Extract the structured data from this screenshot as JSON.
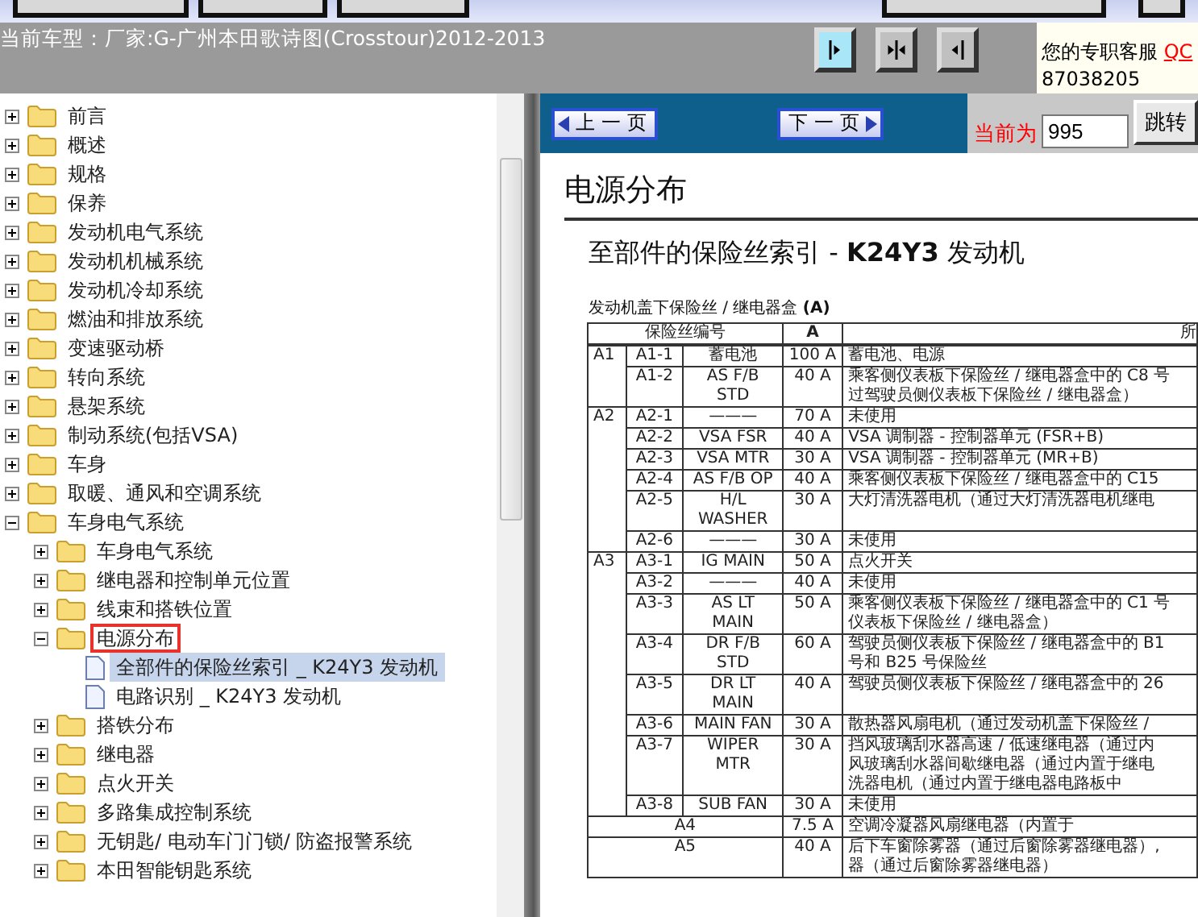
{
  "header": {
    "model_text": "当前车型：厂家:G-广州本田歌诗图(Crosstour)2012-2013",
    "view_buttons": [
      {
        "kind": "right"
      },
      {
        "kind": "both"
      },
      {
        "kind": "left"
      }
    ]
  },
  "service": {
    "text": "您的专职客服",
    "link": "QC",
    "phone": "87038205"
  },
  "tree": [
    {
      "label": "前言",
      "kind": "folder",
      "expanded": false,
      "selected": false,
      "marked": false
    },
    {
      "label": "概述",
      "kind": "folder",
      "expanded": false,
      "selected": false,
      "marked": false
    },
    {
      "label": "规格",
      "kind": "folder",
      "expanded": false,
      "selected": false,
      "marked": false
    },
    {
      "label": "保养",
      "kind": "folder",
      "expanded": false,
      "selected": false,
      "marked": false
    },
    {
      "label": "发动机电气系统",
      "kind": "folder",
      "expanded": false,
      "selected": false,
      "marked": false
    },
    {
      "label": "发动机机械系统",
      "kind": "folder",
      "expanded": false,
      "selected": false,
      "marked": false
    },
    {
      "label": "发动机冷却系统",
      "kind": "folder",
      "expanded": false,
      "selected": false,
      "marked": false
    },
    {
      "label": "燃油和排放系统",
      "kind": "folder",
      "expanded": false,
      "selected": false,
      "marked": false
    },
    {
      "label": "变速驱动桥",
      "kind": "folder",
      "expanded": false,
      "selected": false,
      "marked": false
    },
    {
      "label": "转向系统",
      "kind": "folder",
      "expanded": false,
      "selected": false,
      "marked": false
    },
    {
      "label": "悬架系统",
      "kind": "folder",
      "expanded": false,
      "selected": false,
      "marked": false
    },
    {
      "label": "制动系统(包括VSA)",
      "kind": "folder",
      "expanded": false,
      "selected": false,
      "marked": false
    },
    {
      "label": "车身",
      "kind": "folder",
      "expanded": false,
      "selected": false,
      "marked": false
    },
    {
      "label": "取暖、通风和空调系统",
      "kind": "folder",
      "expanded": false,
      "selected": false,
      "marked": false
    },
    {
      "label": "车身电气系统",
      "kind": "folder",
      "expanded": true,
      "selected": false,
      "marked": false,
      "children": [
        {
          "label": "车身电气系统",
          "kind": "folder",
          "expanded": false,
          "selected": false,
          "marked": false
        },
        {
          "label": "继电器和控制单元位置",
          "kind": "folder",
          "expanded": false,
          "selected": false,
          "marked": false
        },
        {
          "label": "线束和搭铁位置",
          "kind": "folder",
          "expanded": false,
          "selected": false,
          "marked": false
        },
        {
          "label": "电源分布",
          "kind": "folder",
          "expanded": true,
          "selected": false,
          "marked": true,
          "children": [
            {
              "label": "全部件的保险丝索引 _ K24Y3 发动机",
              "kind": "page",
              "selected": true,
              "marked": false
            },
            {
              "label": "电路识别 _ K24Y3 发动机",
              "kind": "page",
              "selected": false,
              "marked": false
            }
          ]
        },
        {
          "label": "搭铁分布",
          "kind": "folder",
          "expanded": false,
          "selected": false,
          "marked": false
        },
        {
          "label": "继电器",
          "kind": "folder",
          "expanded": false,
          "selected": false,
          "marked": false
        },
        {
          "label": "点火开关",
          "kind": "folder",
          "expanded": false,
          "selected": false,
          "marked": false
        },
        {
          "label": "多路集成控制系统",
          "kind": "folder",
          "expanded": false,
          "selected": false,
          "marked": false
        },
        {
          "label": "无钥匙/ 电动车门门锁/ 防盗报警系统",
          "kind": "folder",
          "expanded": false,
          "selected": false,
          "marked": false
        },
        {
          "label": "本田智能钥匙系统",
          "kind": "folder",
          "expanded": false,
          "selected": false,
          "marked": false
        }
      ]
    }
  ],
  "nav": {
    "prev": "上 一 页",
    "next": "下 一 页",
    "current_label": "当前为",
    "page": "995",
    "go": "跳转"
  },
  "document": {
    "title": "电源分布",
    "subtitle": "至部件的保险丝索引 - **K24Y3** 发动机",
    "caption": "发动机盖下保险丝 / 继电器盒 **(A)**",
    "columns": [
      "保险丝编号",
      "A",
      "所"
    ],
    "rows": [
      {
        "kind": "sub",
        "group": "A1",
        "no": "A1-1",
        "name": "蓄电池",
        "amps": "100 A",
        "desc": [
          "蓄电池、电源"
        ]
      },
      {
        "kind": "sub",
        "no": "A1-2",
        "name": "AS F/B STD",
        "amps": "40 A",
        "desc": [
          "乘客侧仪表板下保险丝 / 继电器盒中的 C8 号",
          "过驾驶员侧仪表板下保险丝 / 继电器盒）"
        ]
      },
      {
        "kind": "sub",
        "group": "A2",
        "no": "A2-1",
        "name": "———",
        "amps": "70 A",
        "desc": [
          "未使用"
        ]
      },
      {
        "kind": "sub",
        "no": "A2-2",
        "name": "VSA FSR",
        "amps": "40 A",
        "desc": [
          "VSA 调制器 - 控制器单元 (FSR+B)"
        ]
      },
      {
        "kind": "sub",
        "no": "A2-3",
        "name": "VSA MTR",
        "amps": "30 A",
        "desc": [
          "VSA 调制器 - 控制器单元 (MR+B)"
        ]
      },
      {
        "kind": "sub",
        "no": "A2-4",
        "name": "AS F/B OP",
        "amps": "40 A",
        "desc": [
          "乘客侧仪表板下保险丝 / 继电器盒中的 C15"
        ]
      },
      {
        "kind": "sub",
        "no": "A2-5",
        "name": "H/L WASHER",
        "amps": "30 A",
        "desc": [
          "大灯清洗器电机（通过大灯清洗器电机继电"
        ]
      },
      {
        "kind": "sub",
        "no": "A2-6",
        "name": "———",
        "amps": "30 A",
        "desc": [
          "未使用"
        ]
      },
      {
        "kind": "sub",
        "group": "A3",
        "no": "A3-1",
        "name": "IG MAIN",
        "amps": "50 A",
        "desc": [
          "点火开关"
        ]
      },
      {
        "kind": "sub",
        "no": "A3-2",
        "name": "———",
        "amps": "40 A",
        "desc": [
          "未使用"
        ]
      },
      {
        "kind": "sub",
        "no": "A3-3",
        "name": "AS LT MAIN",
        "amps": "50 A",
        "desc": [
          "乘客侧仪表板下保险丝 / 继电器盒中的 C1 号",
          "仪表板下保险丝 / 继电器盒）"
        ]
      },
      {
        "kind": "sub",
        "no": "A3-4",
        "name": "DR F/B STD",
        "amps": "60 A",
        "desc": [
          "驾驶员侧仪表板下保险丝 / 继电器盒中的 B1",
          "号和 B25 号保险丝"
        ]
      },
      {
        "kind": "sub",
        "no": "A3-5",
        "name": "DR LT MAIN",
        "amps": "40 A",
        "desc": [
          "驾驶员侧仪表板下保险丝 / 继电器盒中的 26"
        ]
      },
      {
        "kind": "sub",
        "no": "A3-6",
        "name": "MAIN FAN",
        "amps": "30 A",
        "desc": [
          "散热器风扇电机（通过发动机盖下保险丝 /"
        ]
      },
      {
        "kind": "sub",
        "no": "A3-7",
        "name": "WIPER MTR",
        "amps": "30 A",
        "desc": [
          "挡风玻璃刮水器高速 / 低速继电器（通过内",
          "风玻璃刮水器间歇继电器（通过内置于继电",
          "洗器电机（通过内置于继电器电路板中"
        ]
      },
      {
        "kind": "sub",
        "no": "A3-8",
        "name": "SUB FAN",
        "amps": "30 A",
        "desc": [
          "未使用"
        ]
      },
      {
        "kind": "single",
        "no": "A4",
        "amps": "7.5 A",
        "desc": [
          "空调冷凝器风扇继电器（内置于"
        ]
      },
      {
        "kind": "single",
        "no": "A5",
        "amps": "40 A",
        "desc": [
          "后下车窗除雾器（通过后窗除雾器继电器）,",
          "器（通过后窗除雾器继电器）"
        ]
      }
    ]
  }
}
